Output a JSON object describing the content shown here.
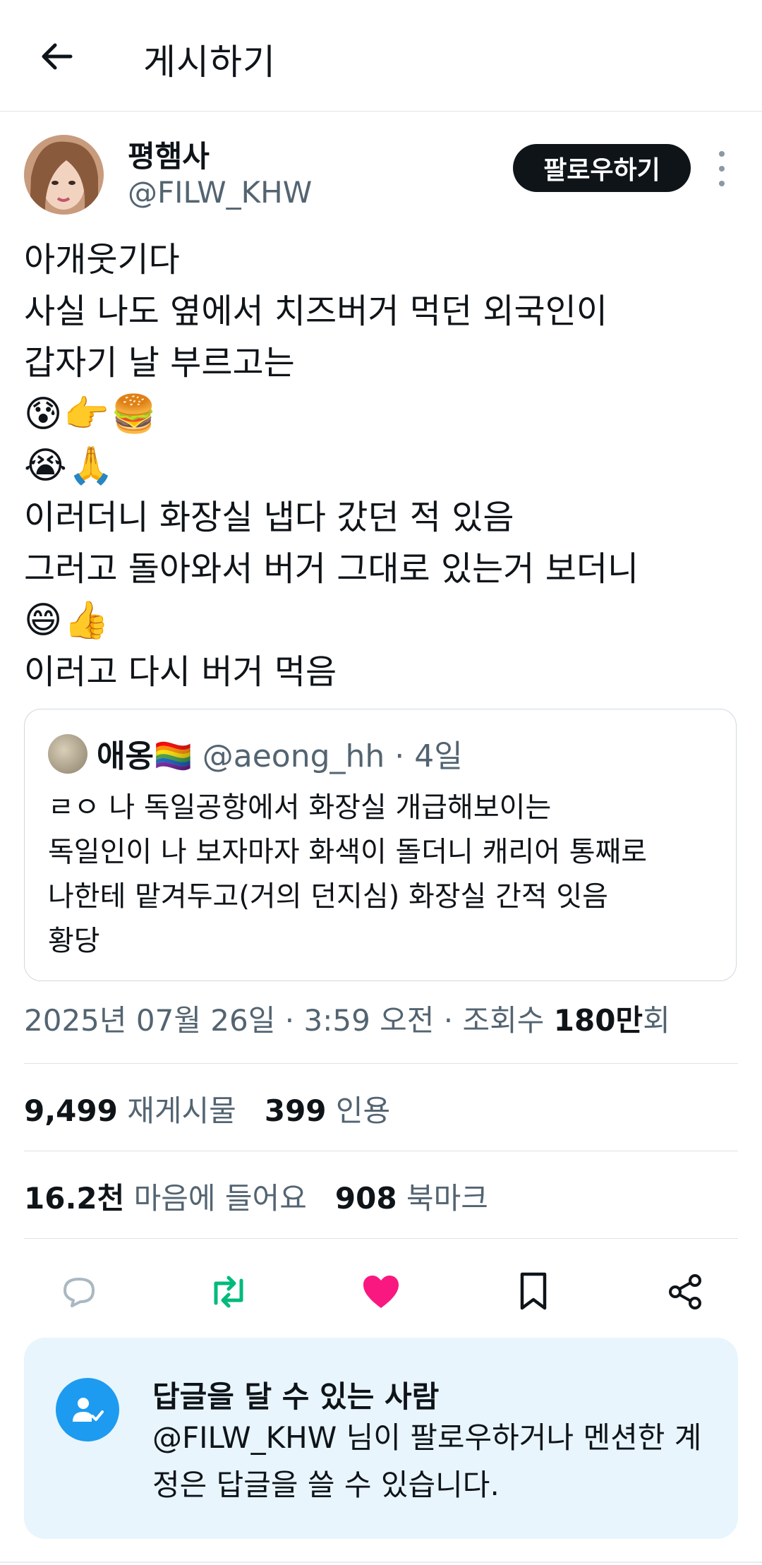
{
  "header": {
    "title": "게시하기",
    "back_icon": "arrow-left-icon"
  },
  "author": {
    "display_name": "평햄사",
    "handle": "@FILW_KHW",
    "follow_label": "팔로우하기",
    "more_icon": "more-vertical-icon"
  },
  "post": {
    "lines": [
      "아개웃기다",
      "사실 나도 옆에서 치즈버거 먹던 외국인이",
      "갑자기 날 부르고는",
      "😰👉🍔",
      "😭🙏",
      "이러더니 화장실 냅다 갔던 적 있음",
      "그러고 돌아와서 버거 그대로 있는거 보더니",
      "😄👍",
      "이러고 다시 버거 먹음"
    ]
  },
  "quote": {
    "name": "애옹",
    "name_emoji": "🏳️‍🌈",
    "handle": "@aeong_hh",
    "separator": " · ",
    "time": "4일",
    "lines": [
      "ㄹㅇ 나 독일공항에서 화장실 개급해보이는",
      "독일인이 나 보자마자 화색이 돌더니 캐리어 통째로",
      "나한테 맡겨두고(거의 던지심) 화장실 간적 잇음",
      "황당"
    ]
  },
  "meta": {
    "date": "2025년 07월 26일",
    "sep1": " · ",
    "time": "3:59 오전",
    "sep2": " · ",
    "views_label": "조회수 ",
    "views_value": "180만",
    "views_suffix": "회"
  },
  "stats": {
    "reposts_value": "9,499",
    "reposts_label": "재게시물",
    "quotes_value": "399",
    "quotes_label": "인용",
    "likes_value": "16.2천",
    "likes_label": "마음에 들어요",
    "bookmarks_value": "908",
    "bookmarks_label": "북마크"
  },
  "actions": {
    "reply_icon": "reply-icon",
    "repost_icon": "repost-icon",
    "like_icon": "heart-icon",
    "bookmark_icon": "bookmark-icon",
    "share_icon": "share-icon"
  },
  "reply_notice": {
    "title": "답글을 달 수 있는 사람",
    "text": "@FILW_KHW 님이 팔로우하거나 멘션한 계정은 답글을 쓸 수 있습니다."
  },
  "colors": {
    "accent_blue": "#1d9bf0",
    "repost_green": "#00ba7c",
    "like_pink": "#f91880",
    "muted_text": "#536471",
    "notice_bg": "#e8f5fd"
  }
}
